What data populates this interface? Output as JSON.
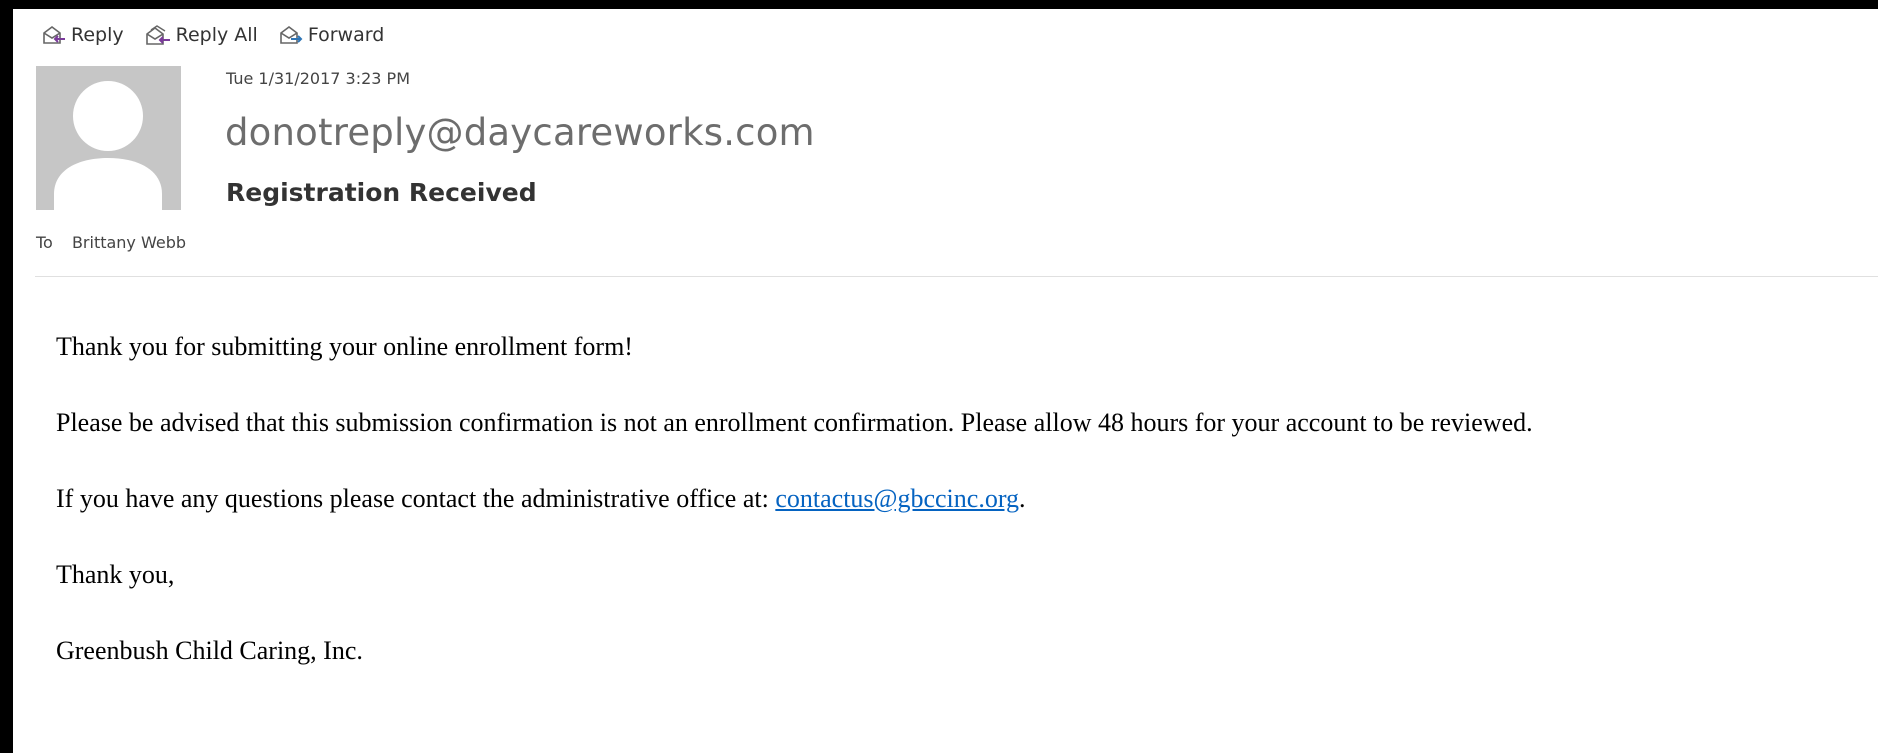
{
  "toolbar": {
    "reply_label": "Reply",
    "reply_all_label": "Reply All",
    "forward_label": "Forward"
  },
  "message": {
    "date": "Tue 1/31/2017 3:23 PM",
    "sender": "donotreply@daycareworks.com",
    "subject": "Registration Received",
    "to_label": "To",
    "to_name": "Brittany Webb"
  },
  "body": {
    "line1": "Thank you for submitting your online enrollment form!",
    "line2": "Please be advised that this submission confirmation is not an enrollment confirmation. Please allow 48 hours for your account to be reviewed.",
    "line3_prefix": "If you have any questions please contact the administrative office at: ",
    "line3_link": "contactus@gbccinc.org",
    "line3_suffix": ".",
    "line4": "Thank you,",
    "line5": "Greenbush Child Caring, Inc."
  },
  "icons": {
    "reply": "reply-icon",
    "reply_all": "reply-all-icon",
    "forward": "forward-icon",
    "avatar": "person-silhouette-icon"
  },
  "colors": {
    "link": "#0563c1",
    "reply_arrow": "#7a3b9a",
    "forward_arrow": "#2e75b6",
    "avatar_bg": "#c6c6c6"
  }
}
